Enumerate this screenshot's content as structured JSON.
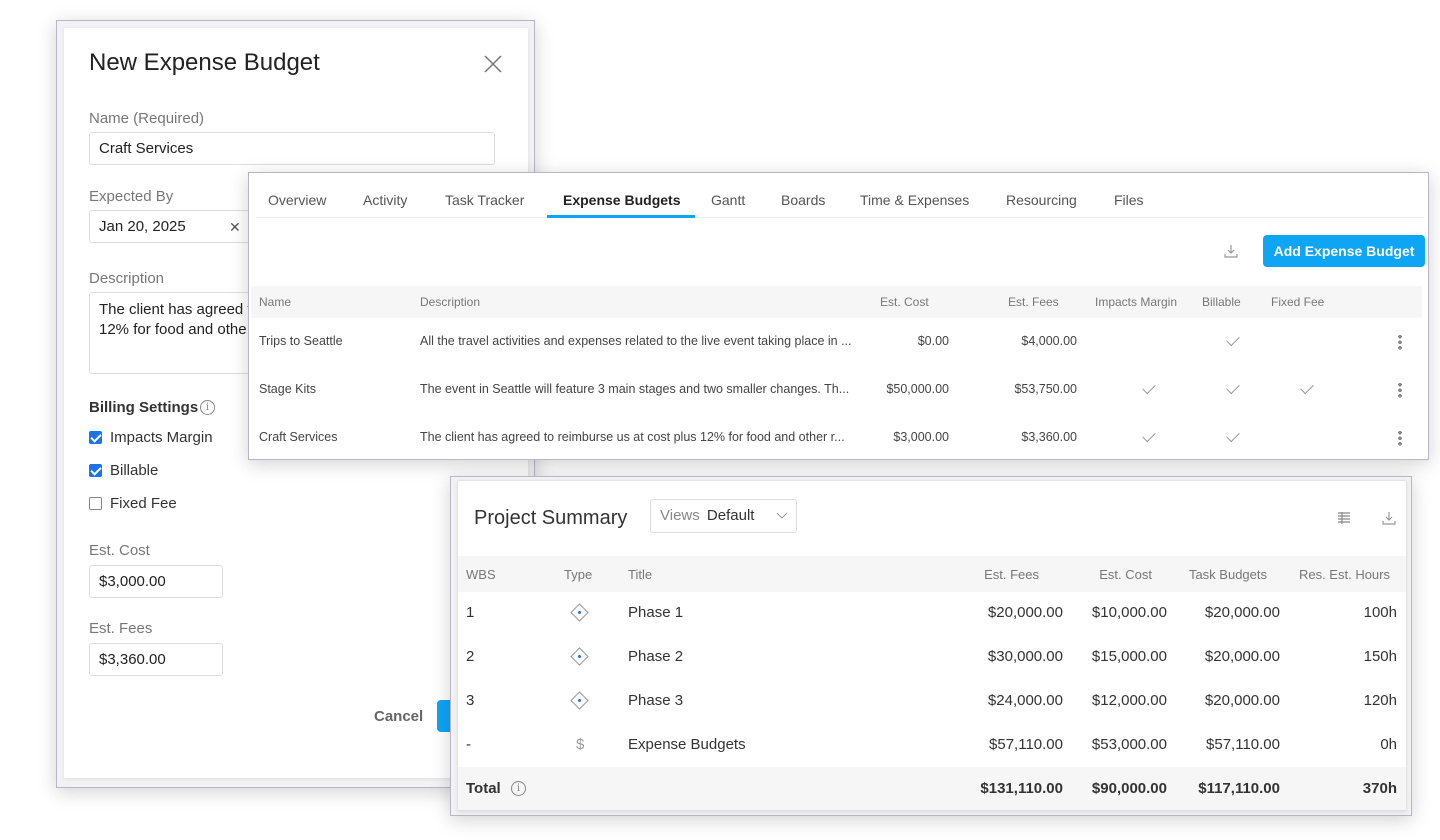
{
  "modal": {
    "title": "New Expense Budget",
    "name_label": "Name (Required)",
    "name_value": "Craft Services",
    "expected_label": "Expected By",
    "expected_value": "Jan 20, 2025",
    "description_label": "Description",
    "description_value": "The client has agreed to reimburse us at cost plus 12% for food and other r",
    "description_visible_line1": "The client has agreed t",
    "description_visible_line2": "12% for food and othe",
    "billing_label": "Billing Settings",
    "checkboxes": [
      {
        "label": "Impacts Margin",
        "checked": true
      },
      {
        "label": "Billable",
        "checked": true
      },
      {
        "label": "Fixed Fee",
        "checked": false
      }
    ],
    "est_cost_label": "Est. Cost",
    "est_cost_value": "$3,000.00",
    "est_fees_label": "Est. Fees",
    "est_fees_value": "$3,360.00",
    "cancel_label": "Cancel"
  },
  "tabs_panel": {
    "tabs": [
      "Overview",
      "Activity",
      "Task Tracker",
      "Expense Budgets",
      "Gantt",
      "Boards",
      "Time & Expenses",
      "Resourcing",
      "Files"
    ],
    "active_tab": "Expense Budgets",
    "add_button": "Add Expense Budget",
    "accent": "#0ea5f5",
    "columns": [
      "Name",
      "Description",
      "Est. Cost",
      "Est. Fees",
      "Impacts Margin",
      "Billable",
      "Fixed Fee"
    ],
    "rows": [
      {
        "name": "Trips to Seattle",
        "description": "All the travel activities and expenses related to the live event taking place in ...",
        "cost": "$0.00",
        "fees": "$4,000.00",
        "impacts_margin": false,
        "billable": true,
        "fixed_fee": false
      },
      {
        "name": "Stage Kits",
        "description": "The event in Seattle will feature 3 main stages and two smaller changes. Th...",
        "cost": "$50,000.00",
        "fees": "$53,750.00",
        "impacts_margin": true,
        "billable": true,
        "fixed_fee": true
      },
      {
        "name": "Craft Services",
        "description": "The client has agreed to reimburse us at cost plus 12% for food and other r...",
        "cost": "$3,000.00",
        "fees": "$3,360.00",
        "impacts_margin": true,
        "billable": true,
        "fixed_fee": false
      }
    ]
  },
  "summary": {
    "title": "Project Summary",
    "views_label": "Views",
    "views_value": "Default",
    "columns": [
      "WBS",
      "Type",
      "Title",
      "Est. Fees",
      "Est. Cost",
      "Task Budgets",
      "Res. Est. Hours"
    ],
    "rows": [
      {
        "wbs": "1",
        "type": "phase-icon",
        "title": "Phase 1",
        "fees": "$20,000.00",
        "cost": "$10,000.00",
        "task_budgets": "$20,000.00",
        "hours": "100h"
      },
      {
        "wbs": "2",
        "type": "phase-icon",
        "title": "Phase 2",
        "fees": "$30,000.00",
        "cost": "$15,000.00",
        "task_budgets": "$20,000.00",
        "hours": "150h"
      },
      {
        "wbs": "3",
        "type": "phase-icon",
        "title": "Phase 3",
        "fees": "$24,000.00",
        "cost": "$12,000.00",
        "task_budgets": "$20,000.00",
        "hours": "120h"
      },
      {
        "wbs": "-",
        "type": "dollar-icon",
        "title": "Expense Budgets",
        "fees": "$57,110.00",
        "cost": "$53,000.00",
        "task_budgets": "$57,110.00",
        "hours": "0h"
      }
    ],
    "total": {
      "label": "Total",
      "fees": "$131,110.00",
      "cost": "$90,000.00",
      "task_budgets": "$117,110.00",
      "hours": "370h"
    },
    "dollar_glyph": "$"
  }
}
